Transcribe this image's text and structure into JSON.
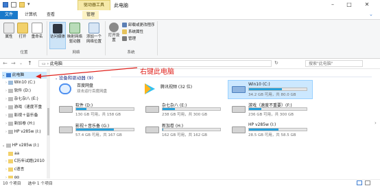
{
  "window": {
    "context_tab": "驱动器工具",
    "title": "此电脑",
    "minimize": "–",
    "maximize": "□",
    "close": "✕"
  },
  "ribbon_tabs": {
    "file": "文件",
    "computer": "计算机",
    "view": "查看",
    "manage": "管理"
  },
  "ribbon": {
    "location": {
      "buttons": [
        "属性",
        "打开",
        "重命名"
      ],
      "label": "位置"
    },
    "network": {
      "buttons": [
        "访问媒体",
        "映射网络驱动器",
        "添加一个网络位置"
      ],
      "label": "网络"
    },
    "system": {
      "open_settings": "打开设置",
      "uninstall": "卸载或更改程序",
      "properties": "系统属性",
      "manage": "管理",
      "label": "系统"
    }
  },
  "address": {
    "path": "此电脑",
    "search_placeholder": "搜索\"此电脑\""
  },
  "nav": {
    "items": [
      "此电脑",
      "Win10 (C:)",
      "软件 (D:)",
      "杂七杂八 (E:)",
      "游戏（速度不重",
      "影视＋音乐备",
      "新加卷 (H:)",
      "HP v285w (I:)",
      "HP v285w (I:)",
      "aa",
      "C历年试题(2010",
      "c语言",
      "gg"
    ]
  },
  "content": {
    "devices_title": "设备和驱动器 (9)",
    "apps": [
      {
        "name": "百度网盘",
        "sub": "双击运行百度网盘"
      },
      {
        "name": "腾讯视频 (32 位)",
        "sub": ""
      }
    ],
    "drives": [
      {
        "name": "Win10 (C:)",
        "sub": "34.2 GB 可用，共 80.0 GB",
        "used": 0.57
      },
      {
        "name": "软件 (D:)",
        "sub": "130 GB 可用，共 158 GB",
        "used": 0.18
      },
      {
        "name": "杂七杂八 (E:)",
        "sub": "238 GB 可用，共 300 GB",
        "used": 0.21
      },
      {
        "name": "游戏（速度不重要）(F:)",
        "sub": "236 GB 可用，共 300 GB",
        "used": 0.21
      },
      {
        "name": "影视＋音乐备 (G:)",
        "sub": "57.4 GB 可用，共 167 GB",
        "used": 0.66
      },
      {
        "name": "新加卷 (H:)",
        "sub": "162 GB 可用，共 162 GB",
        "used": 0.01
      },
      {
        "name": "HP v285w (I:)",
        "sub": "28.5 GB 可用，共 58.5 GB",
        "used": 0.51
      }
    ]
  },
  "annotation": "右键此电脑",
  "status": {
    "count": "10 个项目",
    "selected": "选中 1 个项目"
  },
  "colors": {
    "accent": "#1979ca",
    "bar": "#26a0da",
    "annotation": "#e0201b"
  }
}
